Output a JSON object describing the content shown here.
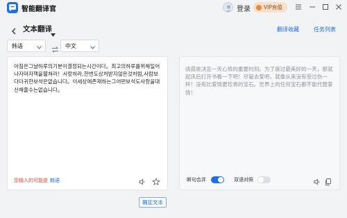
{
  "app": {
    "title": "智能翻译官"
  },
  "titlebar": {
    "login": "登录",
    "vip": "VIP充值"
  },
  "header": {
    "title": "文本翻译",
    "links": {
      "favorites": "翻译收藏",
      "tasks": "任务列表"
    }
  },
  "langs": {
    "source": "韩语",
    "target": "中文"
  },
  "source_panel": {
    "text": "아침은그날하루의기분이결정되는시간이다。최고의하루를위해일어나자마자책을펼쳐라！사랑하라,한번도상처받지않은것처럼,사람보다더귀한보석은없습니다。이세상에존재하는그어떤보석도사랑을대신해줄수는없습니다。",
    "hint": "您输入的可能是",
    "hint_lang": "韩语"
  },
  "target_panel": {
    "text": "清晨是决定一天心情的重要时刻。为了度过最美好的一天，那就起床后打开书看一下吧！尽管去爱吧，就像从来没有受过伤一样！没有比爱情更珍贵的宝石。世界上的任何宝石都不能代替爱情！",
    "toggle_merge": "断句合并",
    "toggle_compare": "双语对照"
  },
  "actions": {
    "translate": "确定文本"
  },
  "colors": {
    "accent": "#1f6fe5",
    "hint": "#e34a3a",
    "vip_bg": "#f7dfc9"
  }
}
